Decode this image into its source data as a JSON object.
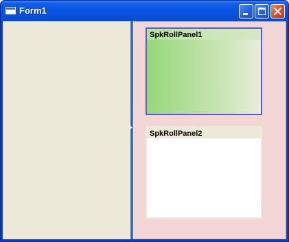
{
  "window": {
    "title": "Form1",
    "controls": {
      "minimize": "minimize-icon",
      "maximize": "maximize-icon",
      "close": "close-icon"
    }
  },
  "right_panel": {
    "background": "#f2d6d6",
    "roll_panels": [
      {
        "title": "SpkRollPanel1",
        "selected": true
      },
      {
        "title": "SpkRollPanel2",
        "selected": false
      }
    ]
  },
  "colors": {
    "titlebar": "#0a55e2",
    "form_background": "#ece9d8",
    "splitter": "#2d58b0",
    "selection_border": "#5a5ad8",
    "gradient_start": "#97d67a",
    "close_button": "#d9482a"
  }
}
